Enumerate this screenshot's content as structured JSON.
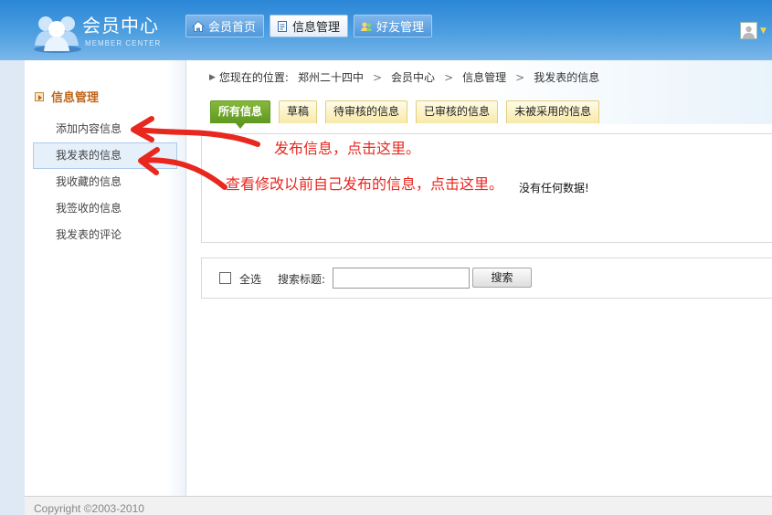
{
  "header": {
    "logo_title": "会员中心",
    "logo_subtitle": "MEMBER CENTER",
    "nav": [
      {
        "label": "会员首页",
        "icon": "home-icon"
      },
      {
        "label": "信息管理",
        "icon": "document-icon",
        "active": true
      },
      {
        "label": "好友管理",
        "icon": "friends-icon"
      }
    ]
  },
  "sidebar": {
    "heading": "信息管理",
    "items": [
      {
        "label": "添加内容信息"
      },
      {
        "label": "我发表的信息",
        "active": true
      },
      {
        "label": "我收藏的信息"
      },
      {
        "label": "我签收的信息"
      },
      {
        "label": "我发表的评论"
      }
    ]
  },
  "breadcrumb": {
    "lead": "您现在的位置:",
    "items": [
      "郑州二十四中",
      "会员中心",
      "信息管理",
      "我发表的信息"
    ],
    "separator": ">"
  },
  "tabs": [
    {
      "label": "所有信息",
      "active": true
    },
    {
      "label": "草稿"
    },
    {
      "label": "待审核的信息"
    },
    {
      "label": "已审核的信息"
    },
    {
      "label": "未被采用的信息"
    }
  ],
  "content": {
    "empty_message": "没有任何数据!"
  },
  "search": {
    "select_all_label": "全选",
    "title_label": "搜索标题:",
    "input_value": "",
    "button_label": "搜索"
  },
  "footer": {
    "copyright": "Copyright ©2003-2010"
  },
  "annotations": {
    "publish_hint": "发布信息，点击这里。",
    "edit_hint": "查看修改以前自己发布的信息，点击这里。",
    "color": "#e8271f"
  },
  "colors": {
    "header_blue": "#2a86d6",
    "sidebar_heading": "#c0661a",
    "active_tab": "#5f9820",
    "tab_bg": "#f8eaa8"
  }
}
